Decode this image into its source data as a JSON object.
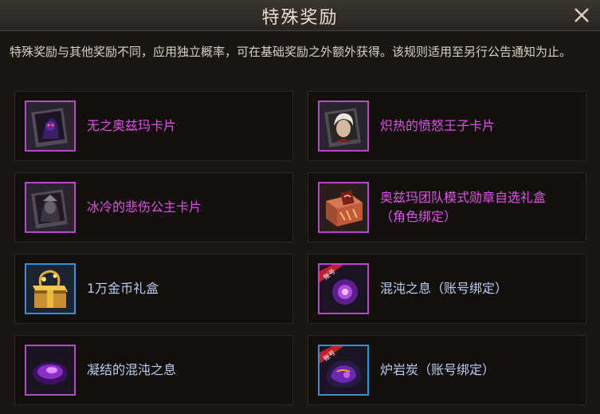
{
  "window": {
    "title": "特殊奖励"
  },
  "description": "特殊奖励与其他奖励不同，应用独立概率，可在基础奖励之外额外获得。该规则适用至另行公告通知为止。",
  "colors": {
    "purple_text": "#e050e8",
    "blue_text": "#b8cdf0",
    "purple_border": "#b24cc2",
    "blue_border": "#3a8fd0"
  },
  "rewards": [
    {
      "label": "无之奥兹玛卡片",
      "icon": "ozma-card-icon",
      "rarity": "purple"
    },
    {
      "label": "炽热的愤怒王子卡片",
      "icon": "prince-card-icon",
      "rarity": "purple"
    },
    {
      "label": "冰冷的悲伤公主卡片",
      "icon": "princess-card-icon",
      "rarity": "purple"
    },
    {
      "label": "奥兹玛团队模式勋章自选礼盒",
      "label2": "（角色绑定）",
      "icon": "medal-box-icon",
      "rarity": "purple"
    },
    {
      "label": "1万金币礼盒",
      "icon": "gold-box-icon",
      "rarity": "blue"
    },
    {
      "label": "混沌之息（账号绑定）",
      "icon": "chaos-breath-icon",
      "rarity": "purple",
      "badge": "账号"
    },
    {
      "label": "凝结的混沌之息",
      "icon": "condensed-chaos-icon",
      "rarity": "purple"
    },
    {
      "label": "炉岩炭（账号绑定）",
      "icon": "furnace-coal-icon",
      "rarity": "purple",
      "badge": "账号"
    }
  ]
}
